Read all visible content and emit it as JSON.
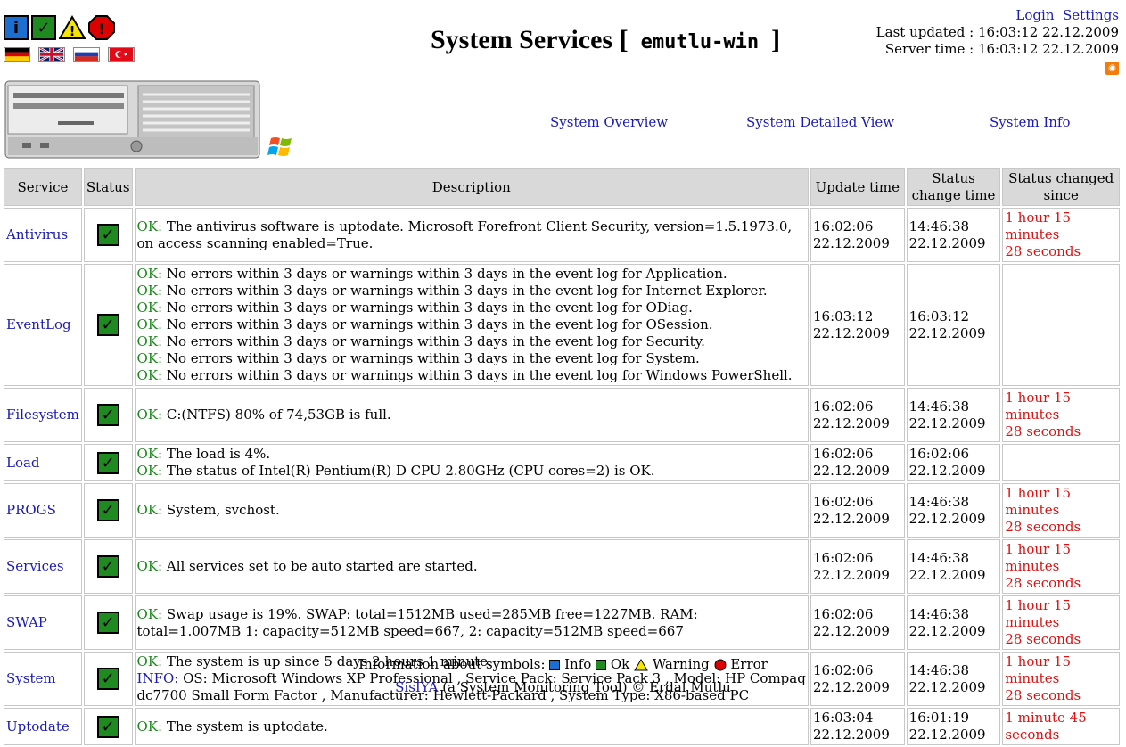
{
  "header": {
    "title_prefix": "System Services [",
    "host": "emutlu-win",
    "title_suffix": "]",
    "login": "Login",
    "settings": "Settings",
    "last_updated": "Last updated : 16:03:12 22.12.2009",
    "server_time": "Server time : 16:03:12 22.12.2009",
    "rss_icon": "rss-icon",
    "nav": {
      "overview": "System Overview",
      "detailed": "System Detailed View",
      "info": "System Info"
    }
  },
  "colors": {
    "ok": "#1a8a1a",
    "info": "#1a1ab8",
    "red": "#e01010",
    "header_bg": "#d9d9d9"
  },
  "table": {
    "headers": [
      "Service",
      "Status",
      "Description",
      "Update time",
      "Status change time",
      "Status changed since"
    ],
    "rows": [
      {
        "service": "Antivirus",
        "lines": [
          {
            "tag": "OK:",
            "text": " The antivirus software is uptodate. Microsoft Forefront Client Security, version=1.5.1973.0, on access scanning enabled=True."
          }
        ],
        "update": [
          "16:02:06",
          "22.12.2009"
        ],
        "change": [
          "14:46:38",
          "22.12.2009"
        ],
        "since": [
          "1 hour 15 minutes",
          "28 seconds"
        ]
      },
      {
        "service": "EventLog",
        "lines": [
          {
            "tag": "OK:",
            "text": " No errors within 3 days or warnings within 3 days in the event log for Application."
          },
          {
            "tag": "OK:",
            "text": " No errors within 3 days or warnings within 3 days in the event log for Internet Explorer."
          },
          {
            "tag": "OK:",
            "text": " No errors within 3 days or warnings within 3 days in the event log for ODiag."
          },
          {
            "tag": "OK:",
            "text": " No errors within 3 days or warnings within 3 days in the event log for OSession."
          },
          {
            "tag": "OK:",
            "text": " No errors within 3 days or warnings within 3 days in the event log for Security."
          },
          {
            "tag": "OK:",
            "text": " No errors within 3 days or warnings within 3 days in the event log for System."
          },
          {
            "tag": "OK:",
            "text": " No errors within 3 days or warnings within 3 days in the event log for Windows PowerShell."
          }
        ],
        "update": [
          "16:03:12",
          "22.12.2009"
        ],
        "change": [
          "16:03:12",
          "22.12.2009"
        ],
        "since": [
          "",
          ""
        ]
      },
      {
        "service": "Filesystem",
        "lines": [
          {
            "tag": "OK:",
            "text": " C:(NTFS) 80% of 74,53GB is full."
          }
        ],
        "update": [
          "16:02:06",
          "22.12.2009"
        ],
        "change": [
          "14:46:38",
          "22.12.2009"
        ],
        "since": [
          "1 hour 15 minutes",
          "28 seconds"
        ]
      },
      {
        "service": "Load",
        "lines": [
          {
            "tag": "OK:",
            "text": " The load is 4%."
          },
          {
            "tag": "OK:",
            "text": " The status of Intel(R) Pentium(R) D CPU 2.80GHz (CPU cores=2) is OK."
          }
        ],
        "update": [
          "16:02:06",
          "22.12.2009"
        ],
        "change": [
          "16:02:06",
          "22.12.2009"
        ],
        "since": [
          "",
          ""
        ]
      },
      {
        "service": "PROGS",
        "lines": [
          {
            "tag": "OK:",
            "text": " System, svchost."
          }
        ],
        "update": [
          "16:02:06",
          "22.12.2009"
        ],
        "change": [
          "14:46:38",
          "22.12.2009"
        ],
        "since": [
          "1 hour 15 minutes",
          "28 seconds"
        ]
      },
      {
        "service": "Services",
        "lines": [
          {
            "tag": "OK:",
            "text": " All services set to be auto started are started."
          }
        ],
        "update": [
          "16:02:06",
          "22.12.2009"
        ],
        "change": [
          "14:46:38",
          "22.12.2009"
        ],
        "since": [
          "1 hour 15 minutes",
          "28 seconds"
        ]
      },
      {
        "service": "SWAP",
        "lines": [
          {
            "tag": "OK:",
            "text": " Swap usage is 19%. SWAP: total=1512MB used=285MB free=1227MB. RAM: total=1.007MB 1: capacity=512MB speed=667, 2: capacity=512MB speed=667"
          }
        ],
        "update": [
          "16:02:06",
          "22.12.2009"
        ],
        "change": [
          "14:46:38",
          "22.12.2009"
        ],
        "since": [
          "1 hour 15 minutes",
          "28 seconds"
        ]
      },
      {
        "service": "System",
        "lines": [
          {
            "tag": "OK:",
            "text": " The system is up since 5 days 2 hours 1 minute."
          },
          {
            "tag": "INFO:",
            "text": " OS: Microsoft Windows XP Professional , Service Pack: Service Pack 3 , Model: HP Compaq dc7700 Small Form Factor , Manufacturer: Hewlett-Packard , System Type: X86-based PC"
          }
        ],
        "update": [
          "16:02:06",
          "22.12.2009"
        ],
        "change": [
          "14:46:38",
          "22.12.2009"
        ],
        "since": [
          "1 hour 15 minutes",
          "28 seconds"
        ]
      },
      {
        "service": "Uptodate",
        "lines": [
          {
            "tag": "OK:",
            "text": " The system is uptodate."
          }
        ],
        "update": [
          "16:03:04",
          "22.12.2009"
        ],
        "change": [
          "16:01:19",
          "22.12.2009"
        ],
        "since": [
          "1 minute 45 seconds",
          ""
        ]
      }
    ]
  },
  "footer": {
    "symbols_label": "Information about symbols:",
    "info": "Info",
    "ok": "Ok",
    "warning": "Warning",
    "error": "Error",
    "sisiya": "SisIYA",
    "tagline": "(a System Monitoring Tool) © Erdal Mutlu"
  }
}
